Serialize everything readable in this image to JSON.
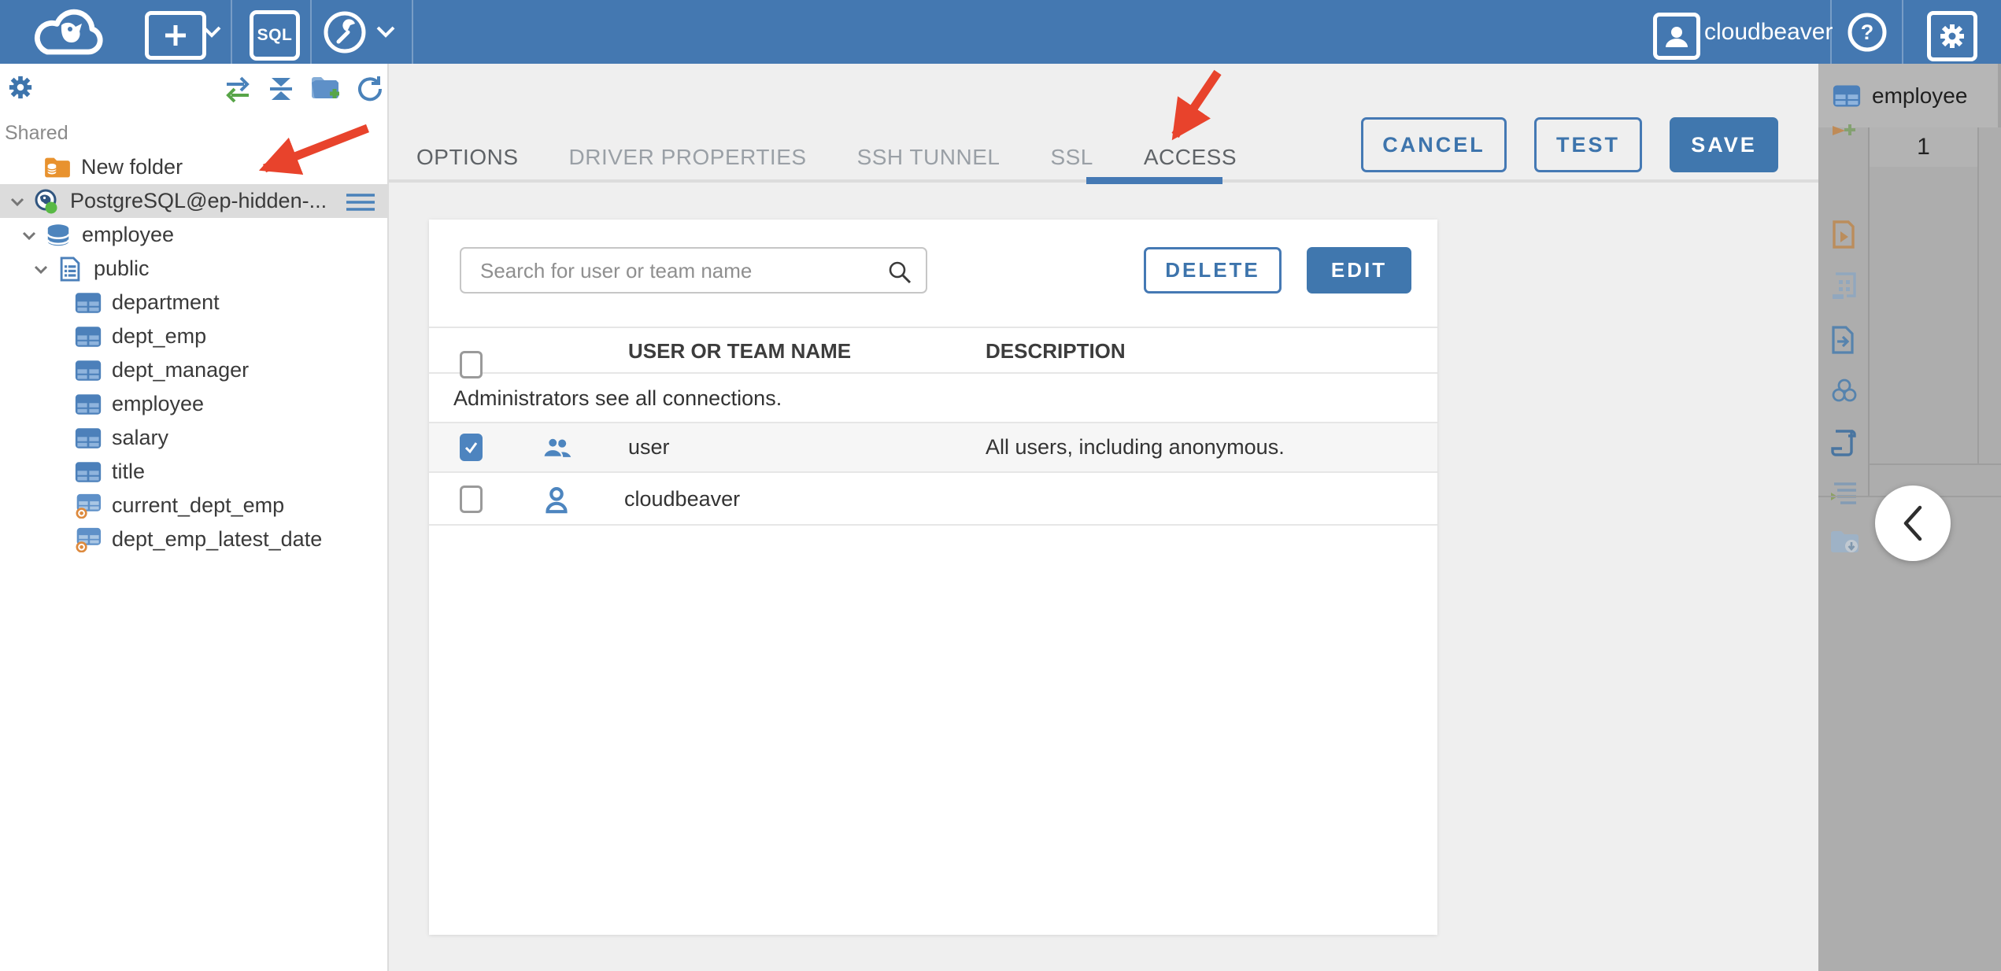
{
  "header": {
    "user_label": "cloudbeaver",
    "sql_badge_label": "SQL"
  },
  "sidebar": {
    "section_label": "Shared",
    "items": [
      {
        "label": "New folder",
        "type": "folder"
      },
      {
        "label": "PostgreSQL@ep-hidden-...",
        "type": "connection",
        "selected": true
      },
      {
        "label": "employee",
        "type": "database"
      },
      {
        "label": "public",
        "type": "schema"
      },
      {
        "label": "department",
        "type": "table"
      },
      {
        "label": "dept_emp",
        "type": "table"
      },
      {
        "label": "dept_manager",
        "type": "table"
      },
      {
        "label": "employee",
        "type": "table"
      },
      {
        "label": "salary",
        "type": "table"
      },
      {
        "label": "title",
        "type": "table"
      },
      {
        "label": "current_dept_emp",
        "type": "view"
      },
      {
        "label": "dept_emp_latest_date",
        "type": "view"
      }
    ]
  },
  "main": {
    "tabs": [
      {
        "label": "OPTIONS"
      },
      {
        "label": "DRIVER PROPERTIES"
      },
      {
        "label": "SSH TUNNEL"
      },
      {
        "label": "SSL"
      },
      {
        "label": "ACCESS"
      }
    ],
    "active_tab": "ACCESS",
    "buttons": {
      "cancel": "CANCEL",
      "test": "TEST",
      "save": "SAVE"
    },
    "access": {
      "search_placeholder": "Search for user or team name",
      "delete_label": "DELETE",
      "edit_label": "EDIT",
      "columns": {
        "name": "USER OR TEAM NAME",
        "description": "DESCRIPTION"
      },
      "info_row": "Administrators see all connections.",
      "rows": [
        {
          "name": "user",
          "description": "All users, including anonymous.",
          "checked": true,
          "icon": "team"
        },
        {
          "name": "cloudbeaver",
          "description": "",
          "checked": false,
          "icon": "user"
        }
      ]
    }
  },
  "right_panel": {
    "tab_label": "employee",
    "row_number": "1"
  },
  "colors": {
    "header_blue": "#4478b1",
    "accent_blue": "#4077ae",
    "tab_underline": "#4579b4",
    "checkbox_checked": "#4d84bf",
    "selected_row_gray": "#dcdcdc",
    "arrow_red": "#e8432c"
  }
}
